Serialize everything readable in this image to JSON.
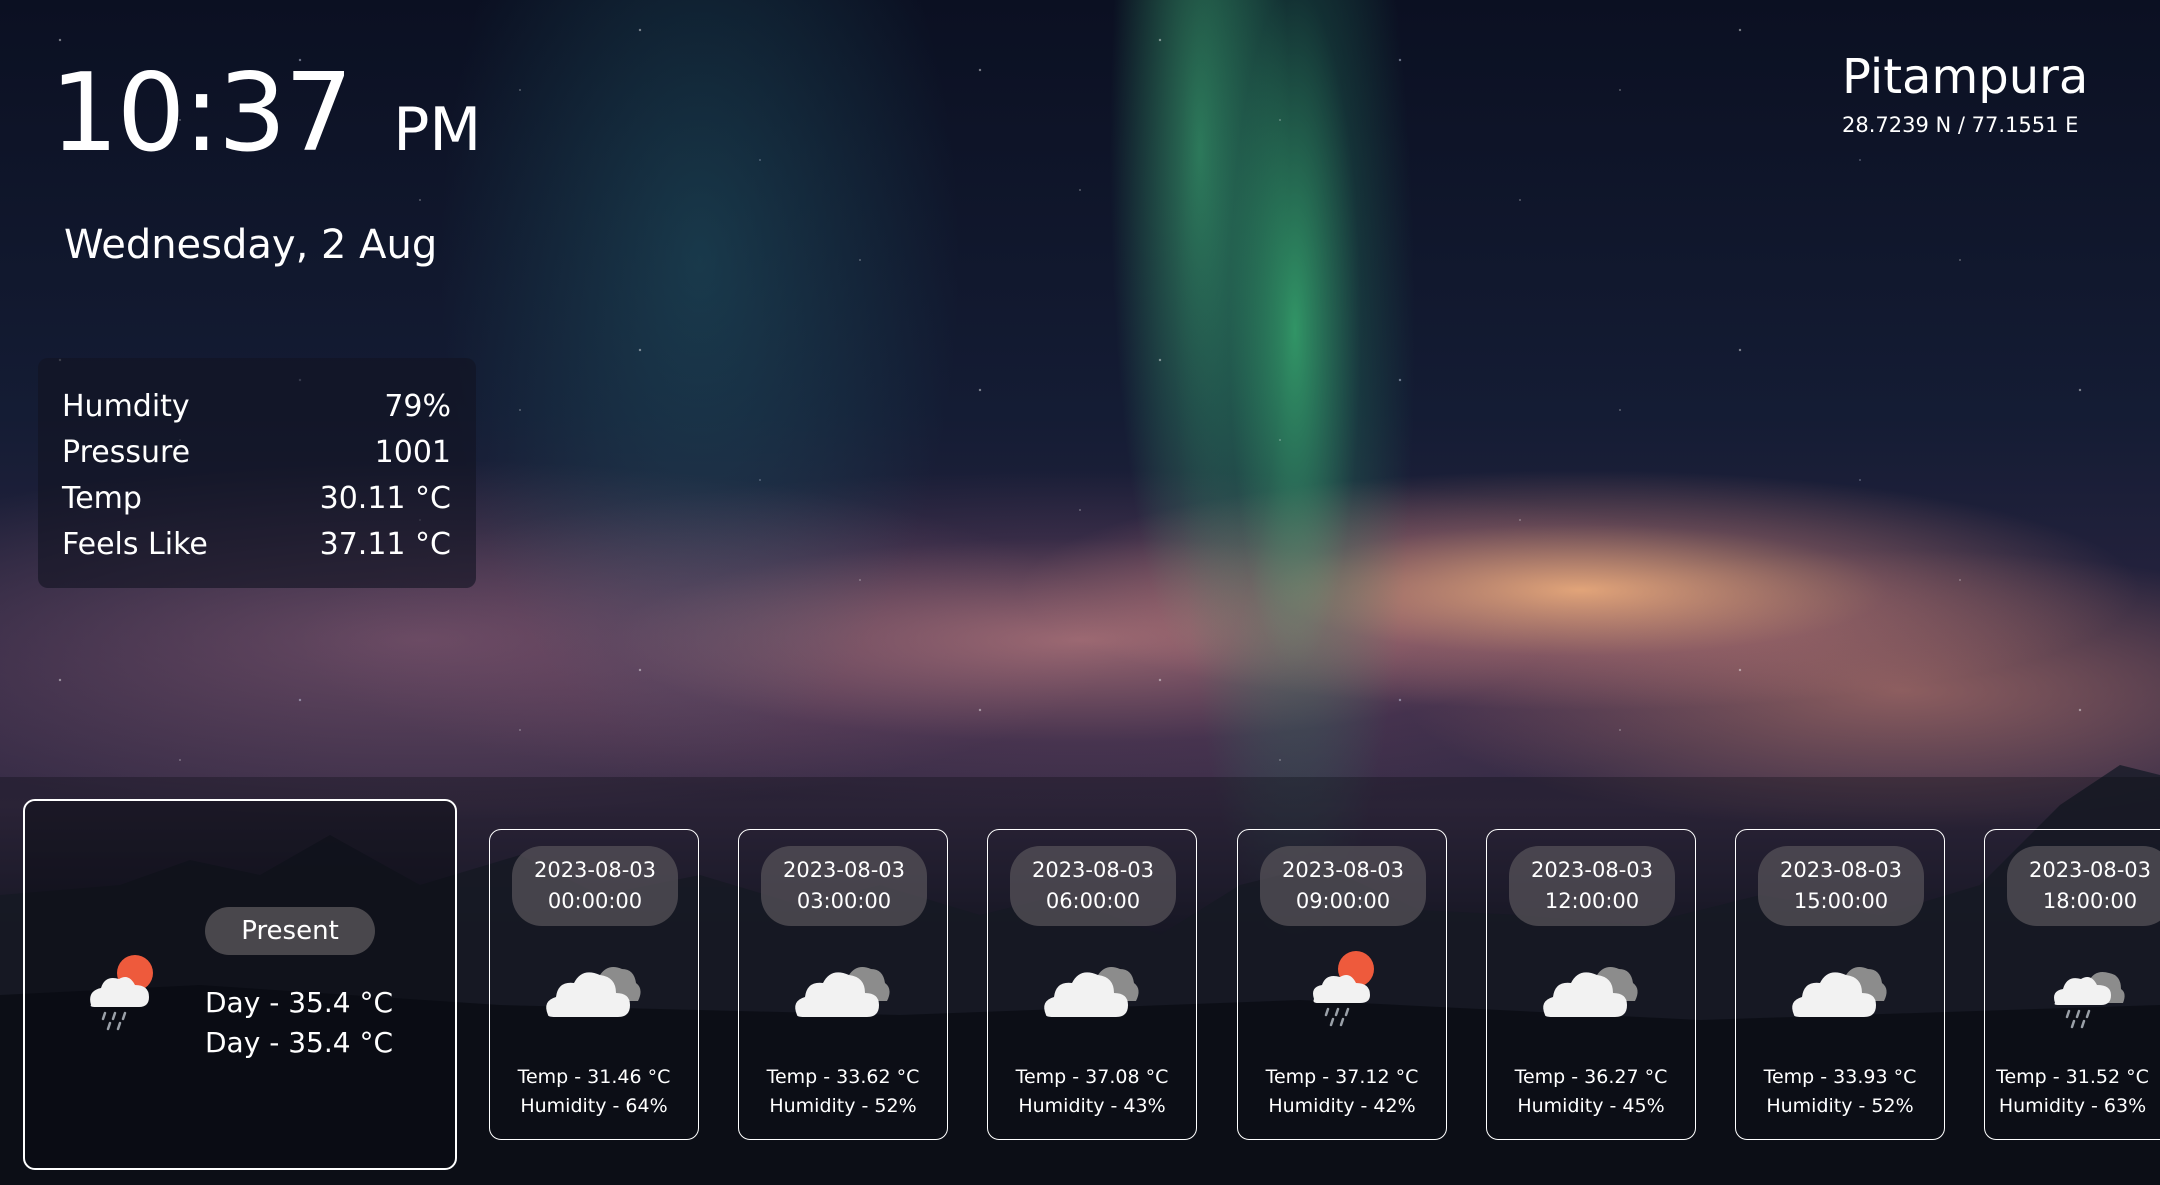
{
  "clock": {
    "time": "10:37",
    "ampm": "PM"
  },
  "date": "Wednesday, 2 Aug",
  "location": {
    "name": "Pitampura",
    "coords": "28.7239 N / 77.1551 E"
  },
  "stats": [
    {
      "label": "Humdity",
      "value": "79%"
    },
    {
      "label": "Pressure",
      "value": "1001"
    },
    {
      "label": "Temp",
      "value": "30.11 °C"
    },
    {
      "label": "Feels Like",
      "value": "37.11 °C"
    }
  ],
  "present": {
    "label": "Present",
    "line1": "Day - 35.4 °C",
    "line2": "Day - 35.4 °C",
    "icon": "sun-cloud-rain-icon"
  },
  "forecast": [
    {
      "date": "2023-08-03",
      "time": "00:00:00",
      "temp": "Temp - 31.46 °C",
      "humidity": "Humidity - 64%",
      "icon": "cloud-icon"
    },
    {
      "date": "2023-08-03",
      "time": "03:00:00",
      "temp": "Temp - 33.62 °C",
      "humidity": "Humidity - 52%",
      "icon": "cloud-icon"
    },
    {
      "date": "2023-08-03",
      "time": "06:00:00",
      "temp": "Temp - 37.08 °C",
      "humidity": "Humidity - 43%",
      "icon": "cloud-icon"
    },
    {
      "date": "2023-08-03",
      "time": "09:00:00",
      "temp": "Temp - 37.12 °C",
      "humidity": "Humidity - 42%",
      "icon": "sun-cloud-rain-icon"
    },
    {
      "date": "2023-08-03",
      "time": "12:00:00",
      "temp": "Temp - 36.27 °C",
      "humidity": "Humidity - 45%",
      "icon": "cloud-icon"
    },
    {
      "date": "2023-08-03",
      "time": "15:00:00",
      "temp": "Temp - 33.93 °C",
      "humidity": "Humidity - 52%",
      "icon": "cloud-icon"
    },
    {
      "date": "2023-08-03",
      "time": "18:00:00",
      "temp": "Temp - 31.52 °C",
      "humidity": "Humidity - 63%",
      "icon": "cloud-rain-icon"
    }
  ],
  "colors": {
    "sun": "#ee5a3c",
    "cloud": "#f2f2f2",
    "cloud_back": "#8c8c8c",
    "pill": "#555258"
  }
}
